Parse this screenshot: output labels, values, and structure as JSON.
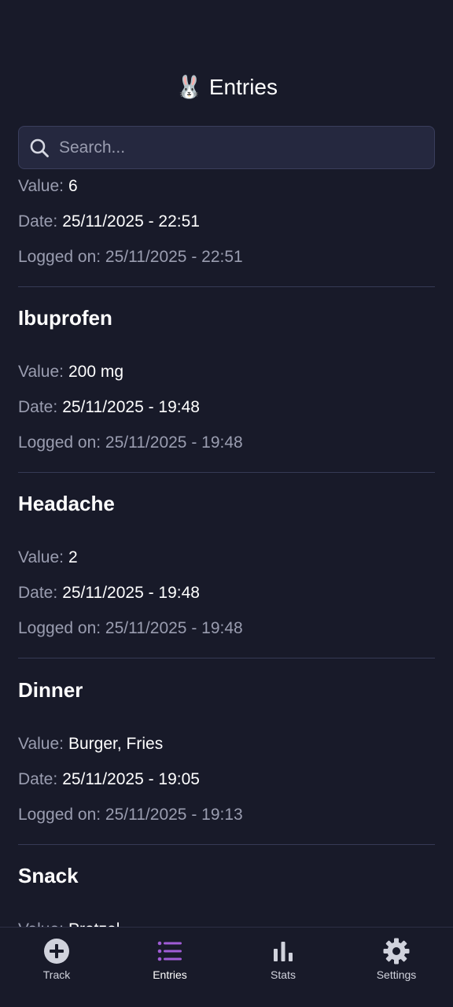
{
  "header": {
    "emoji": "🐰",
    "title": "Entries"
  },
  "search": {
    "placeholder": "Search...",
    "value": ""
  },
  "partial_entry": {
    "value_label": "Value:",
    "value": "6",
    "date_label": "Date:",
    "date": "25/11/2025 - 22:51",
    "logged": "Logged on: 25/11/2025 - 22:51"
  },
  "entries": [
    {
      "title": "Ibuprofen",
      "value_label": "Value:",
      "value": "200 mg",
      "date_label": "Date:",
      "date": "25/11/2025 - 19:48",
      "logged": "Logged on: 25/11/2025 - 19:48"
    },
    {
      "title": "Headache",
      "value_label": "Value:",
      "value": "2",
      "date_label": "Date:",
      "date": "25/11/2025 - 19:48",
      "logged": "Logged on: 25/11/2025 - 19:48"
    },
    {
      "title": "Dinner",
      "value_label": "Value:",
      "value": "Burger, Fries",
      "date_label": "Date:",
      "date": "25/11/2025 - 19:05",
      "logged": "Logged on: 25/11/2025 - 19:13"
    },
    {
      "title": "Snack",
      "value_label": "Value:",
      "value": "Pretzel",
      "date_label": "",
      "date": "",
      "logged": ""
    }
  ],
  "nav": {
    "items": [
      {
        "label": "Track",
        "icon": "plus-circle-icon",
        "active": false
      },
      {
        "label": "Entries",
        "icon": "list-icon",
        "active": true
      },
      {
        "label": "Stats",
        "icon": "bar-chart-icon",
        "active": false
      },
      {
        "label": "Settings",
        "icon": "gear-icon",
        "active": false
      }
    ]
  },
  "colors": {
    "background": "#181a29",
    "accent": "#a05cd6",
    "label": "#9a9db0",
    "divider": "#363a55"
  }
}
